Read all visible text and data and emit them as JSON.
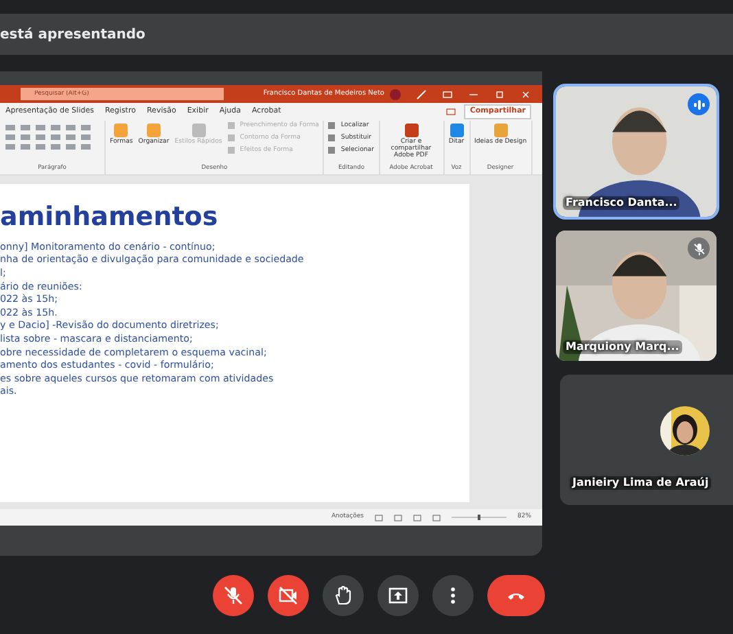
{
  "presenter_bar": {
    "text": "está apresentando"
  },
  "powerpoint": {
    "search_placeholder": "Pesquisar (Alt+G)",
    "user_name": "Francisco Dantas de Medeiros Neto",
    "tabs": [
      {
        "label": "Apresentação de Slides",
        "selected": false
      },
      {
        "label": "Registro",
        "selected": false
      },
      {
        "label": "Revisão",
        "selected": false
      },
      {
        "label": "Exibir",
        "selected": false
      },
      {
        "label": "Ajuda",
        "selected": false
      },
      {
        "label": "Acrobat",
        "selected": false
      }
    ],
    "share_button": "Compartilhar",
    "ribbon_groups": [
      {
        "label": "Parágrafo"
      },
      {
        "label": "Desenho",
        "commands": [
          {
            "kind": "large",
            "label": "Formas",
            "disabled": false
          },
          {
            "kind": "large",
            "label": "Organizar",
            "disabled": false
          },
          {
            "kind": "large",
            "label": "Estilos Rápidos",
            "disabled": true
          },
          {
            "kind": "small",
            "label": "Preenchimento da Forma",
            "disabled": true
          },
          {
            "kind": "small",
            "label": "Contorno da Forma",
            "disabled": true
          },
          {
            "kind": "small",
            "label": "Efeitos de Forma",
            "disabled": true
          }
        ]
      },
      {
        "label": "Editando",
        "commands": [
          {
            "kind": "small",
            "label": "Localizar",
            "disabled": false
          },
          {
            "kind": "small",
            "label": "Substituir",
            "disabled": false
          },
          {
            "kind": "small",
            "label": "Selecionar",
            "disabled": false
          }
        ]
      },
      {
        "label": "Adobe Acrobat",
        "commands": [
          {
            "kind": "large",
            "label": "Criar e compartilhar Adobe PDF",
            "disabled": false
          }
        ]
      },
      {
        "label": "Voz",
        "commands": [
          {
            "kind": "large",
            "label": "Ditar",
            "disabled": false
          }
        ]
      },
      {
        "label": "Designer",
        "commands": [
          {
            "kind": "large",
            "label": "Ideias de Design",
            "disabled": false
          }
        ]
      }
    ],
    "slide": {
      "title": "aminhamentos",
      "lines": [
        "onny] Monitoramento do cenário - contínuo;",
        "nha de orientação e divulgação para comunidade e sociedade",
        "l;",
        "ário de reuniões:",
        "022 às 15h;",
        "022 às 15h.",
        "y e Dacio]  -Revisão do documento diretrizes;",
        "lista  sobre - mascara e distanciamento;",
        "obre necessidade de completarem o esquema vacinal;",
        "amento dos estudantes - covid - formulário;",
        "es sobre aqueles cursos que retomaram com atividades",
        "ais."
      ]
    },
    "status_bar": {
      "notes": "Anotações",
      "zoom_slider": {
        "level": 0.5
      },
      "zoom": "82%"
    }
  },
  "participants": [
    {
      "kind": "video",
      "name": "Francisco Danta...",
      "speaking": true,
      "muted": false
    },
    {
      "kind": "video",
      "name": "Marquiony Marq...",
      "speaking": false,
      "muted": true
    },
    {
      "kind": "avatar",
      "name": "Janieiry Lima de Araúj",
      "speaking": false,
      "muted": false
    }
  ],
  "controls": [
    {
      "kind": "mic",
      "off": true
    },
    {
      "kind": "camera",
      "off": true
    },
    {
      "kind": "hand",
      "off": false
    },
    {
      "kind": "present",
      "off": false
    },
    {
      "kind": "more",
      "off": false
    },
    {
      "kind": "leave",
      "off": false
    }
  ]
}
